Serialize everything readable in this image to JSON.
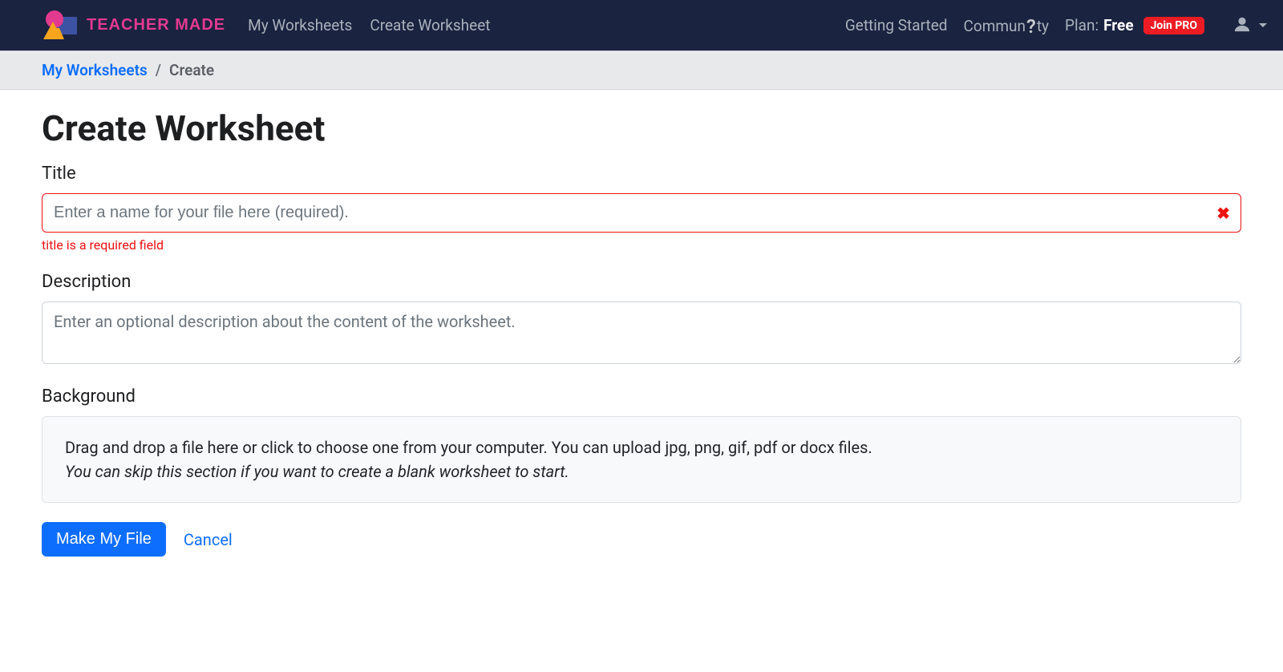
{
  "navbar": {
    "brand_text": "TEACHER MADE",
    "links": {
      "my_worksheets": "My Worksheets",
      "create_worksheet": "Create Worksheet",
      "getting_started": "Getting Started",
      "community_prefix": "Commun",
      "community_q": "?",
      "community_suffix": "ty"
    },
    "plan_label": "Plan:",
    "plan_value": "Free",
    "join_pro": "Join PRO"
  },
  "breadcrumb": {
    "root": "My Worksheets",
    "separator": "/",
    "current": "Create"
  },
  "page": {
    "title": "Create Worksheet"
  },
  "form": {
    "title_label": "Title",
    "title_placeholder": "Enter a name for your file here (required).",
    "title_value": "",
    "title_error": "title is a required field",
    "description_label": "Description",
    "description_placeholder": "Enter an optional description about the content of the worksheet.",
    "description_value": "",
    "background_label": "Background",
    "background_line1": "Drag and drop a file here or click to choose one from your computer. You can upload jpg, png, gif, pdf or docx files.",
    "background_line2": "You can skip this section if you want to create a blank worksheet to start."
  },
  "actions": {
    "make_file": "Make My File",
    "cancel": "Cancel"
  }
}
